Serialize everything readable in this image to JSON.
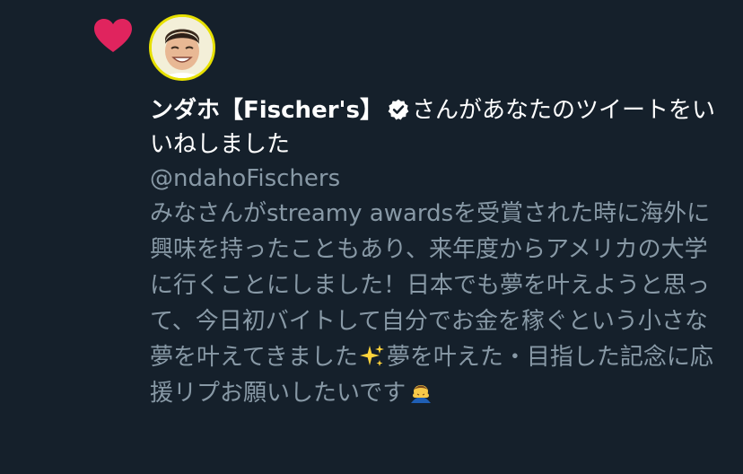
{
  "notification": {
    "display_name": "ンダホ【Fischer's】",
    "action_text": "さんがあなたのツイートをいいねしました",
    "handle": "@ndahoFischers",
    "tweet_part1": "みなさんがstreamy awardsを受賞された時に海外に興味を持ったこともあり、来年度からアメリカの大学に行くことにしました！日本でも夢を叶えようと思って、今日初バイトして自分でお金を稼ぐという小さな夢を叶えてきました",
    "tweet_part2": "夢を叶えた・目指した記念に応援リプお願いしたいです",
    "emoji_1": "sparkles-icon",
    "emoji_2": "bowing-person-icon"
  },
  "colors": {
    "background": "#15202b",
    "like_heart": "#e0245e",
    "primary_text": "#ffffff",
    "secondary_text": "#8899a6",
    "avatar_ring": "#e7e000"
  }
}
